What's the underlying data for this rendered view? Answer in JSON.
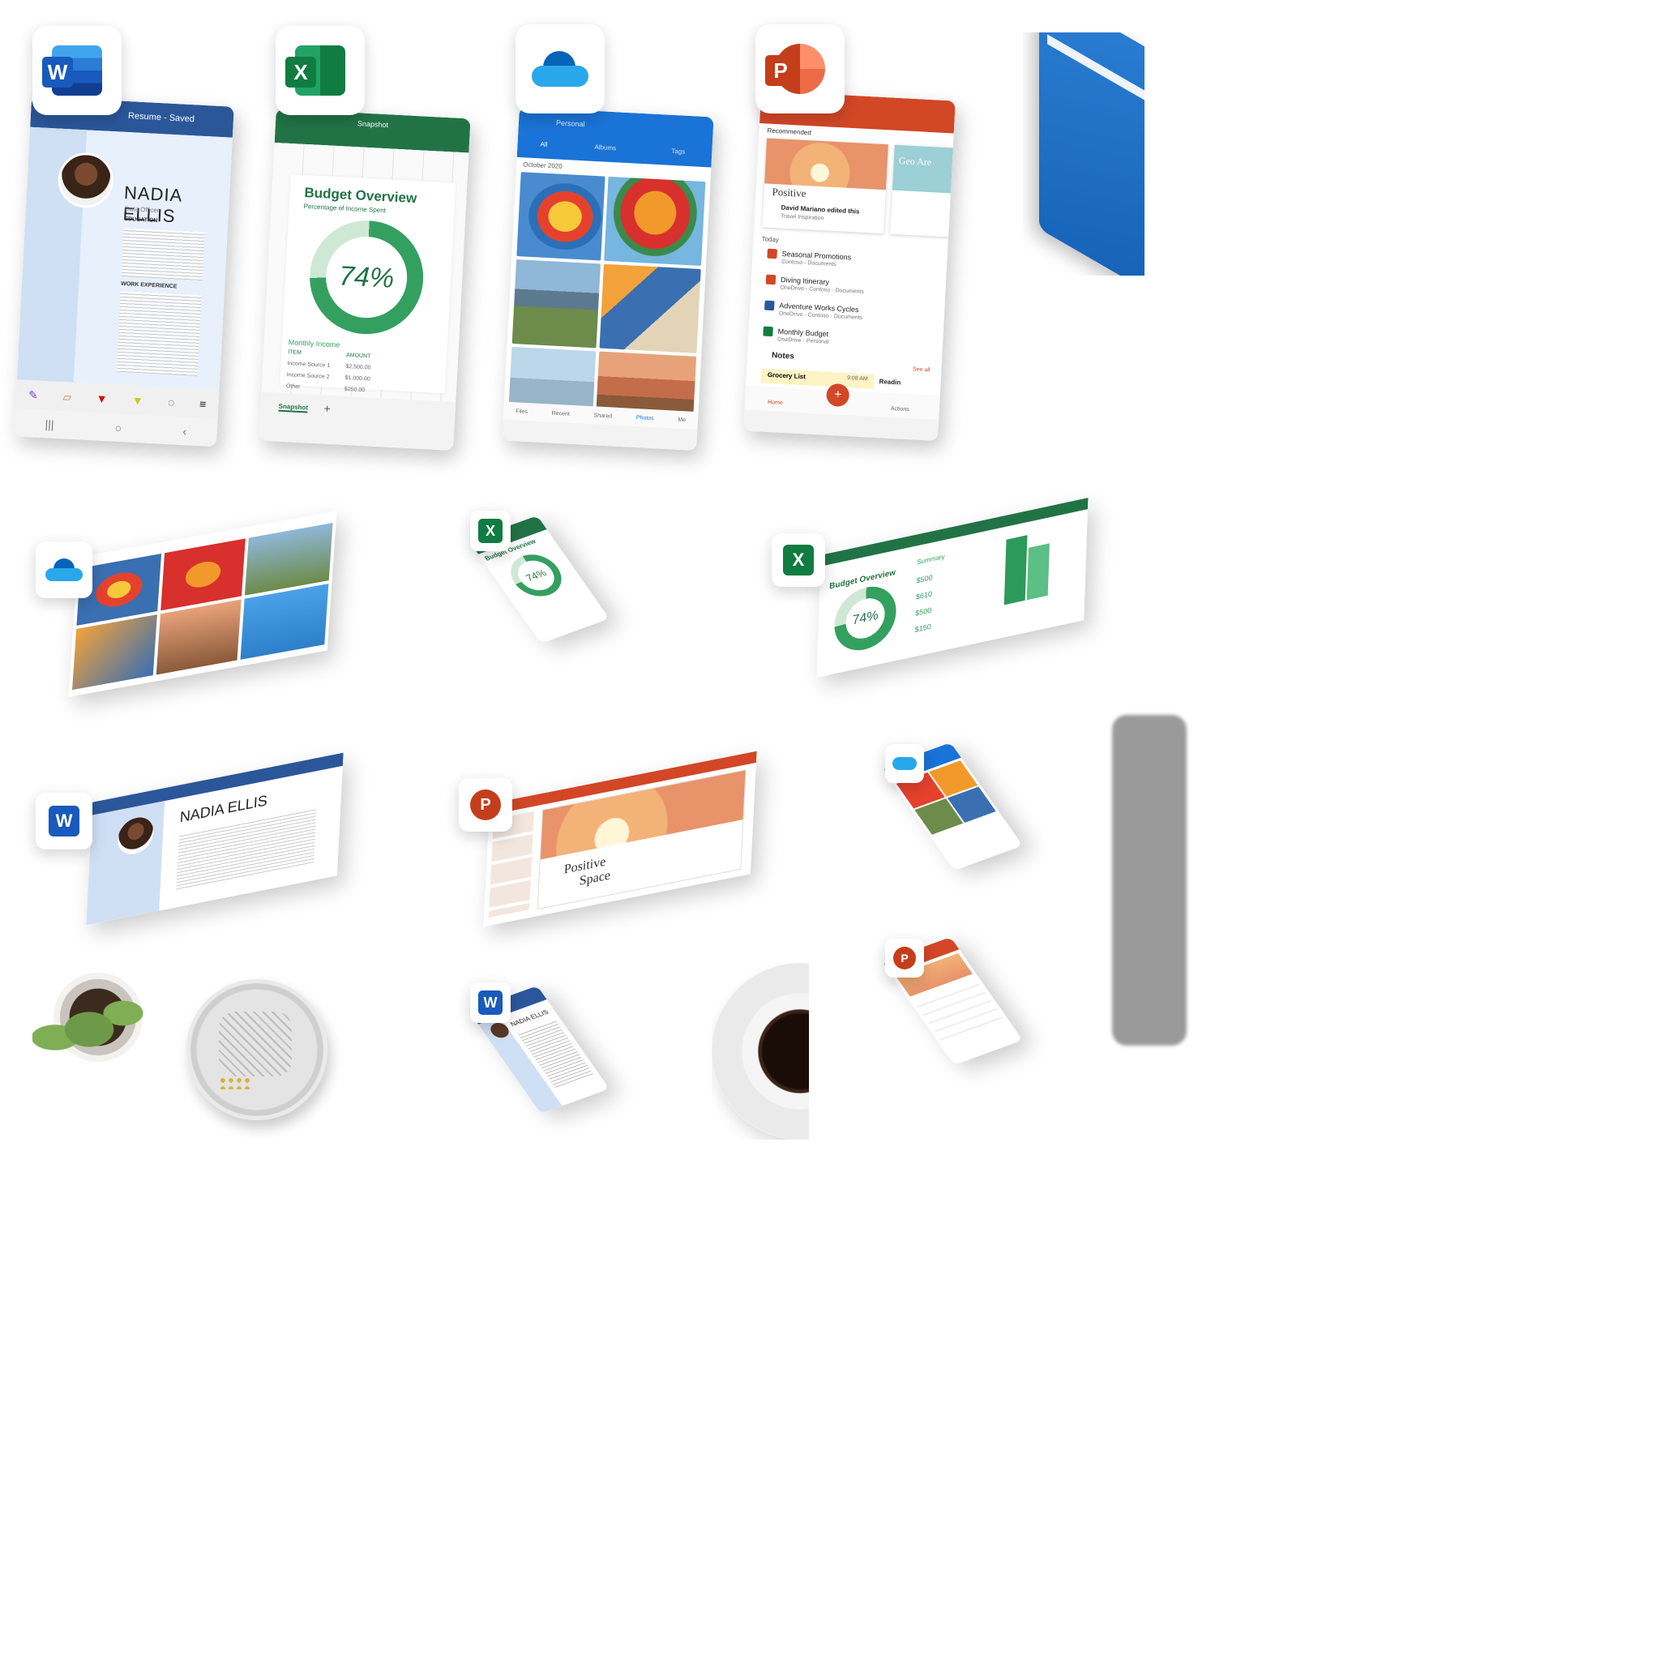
{
  "word_phone": {
    "title": "Resume - Saved",
    "name": "NADIA ELLIS",
    "subtitle": "Data Officer",
    "section_education": "EDUCATION",
    "section_work": "WORK EXPERIENCE"
  },
  "excel_phone": {
    "sheet_title": "Snapshot",
    "heading": "Budget Overview",
    "subheading": "Percentage of Income Spent",
    "percent": "74%",
    "percent_value": 74,
    "monthly_income": "Monthly Income",
    "col_item": "ITEM",
    "col_amount": "AMOUNT",
    "rows": [
      {
        "item": "Income Source 1",
        "amount": "$2,500.00"
      },
      {
        "item": "Income Source 2",
        "amount": "$1,000.00"
      },
      {
        "item": "Other",
        "amount": "$250.00"
      }
    ],
    "tab": "Snapshot",
    "add_tab": "+"
  },
  "onedrive_phone": {
    "account": "Personal",
    "tabs": [
      "All",
      "Albums",
      "Tags"
    ],
    "date": "October 2020",
    "nav": [
      "Files",
      "Recent",
      "Shared",
      "Photos",
      "Me"
    ]
  },
  "ppt_phone": {
    "recommended": "Recommended",
    "card_title": "Positive",
    "card_editor": "David Mariano edited this",
    "card_file": "Travel Inspiration",
    "card2_title": "Geo Are",
    "today": "Today",
    "files": [
      {
        "name": "Seasonal Promotions",
        "loc": "Contoso - Documents",
        "type": "ppt"
      },
      {
        "name": "Diving Itinerary",
        "loc": "OneDrive - Contoso - Documents",
        "type": "ppt"
      },
      {
        "name": "Adventure Works Cycles",
        "loc": "OneDrive - Contoso - Documents",
        "type": "word"
      },
      {
        "name": "Monthly Budget",
        "loc": "OneDrive - Personal",
        "type": "excel"
      }
    ],
    "notes": "Notes",
    "see_all": "See all",
    "note_item": "Grocery List",
    "note_time": "9:08 AM",
    "note_item2": "Readin",
    "nav_home": "Home",
    "nav_actions": "Actions",
    "fab": "+"
  },
  "excel_tablet": {
    "heading": "Budget Overview",
    "percent": "74%",
    "summary": "Summary",
    "values": [
      "$500",
      "$610",
      "$500",
      "$150"
    ]
  },
  "excel_small_phone": {
    "heading": "Budget Overview",
    "percent": "74%"
  },
  "word_laptop": {
    "name": "NADIA ELLIS"
  },
  "ppt_laptop": {
    "slide_title_1": "Positive",
    "slide_title_2": "Space"
  },
  "word_small_phone": {
    "name": "NADIA ELLIS"
  },
  "icons": {
    "word": {
      "letter": "W",
      "color": "#2b579a"
    },
    "excel": {
      "letter": "X",
      "color": "#107c41"
    },
    "onedrive": {
      "color": "#0f78d4"
    },
    "powerpoint": {
      "letter": "P",
      "color": "#c43e1c"
    }
  }
}
